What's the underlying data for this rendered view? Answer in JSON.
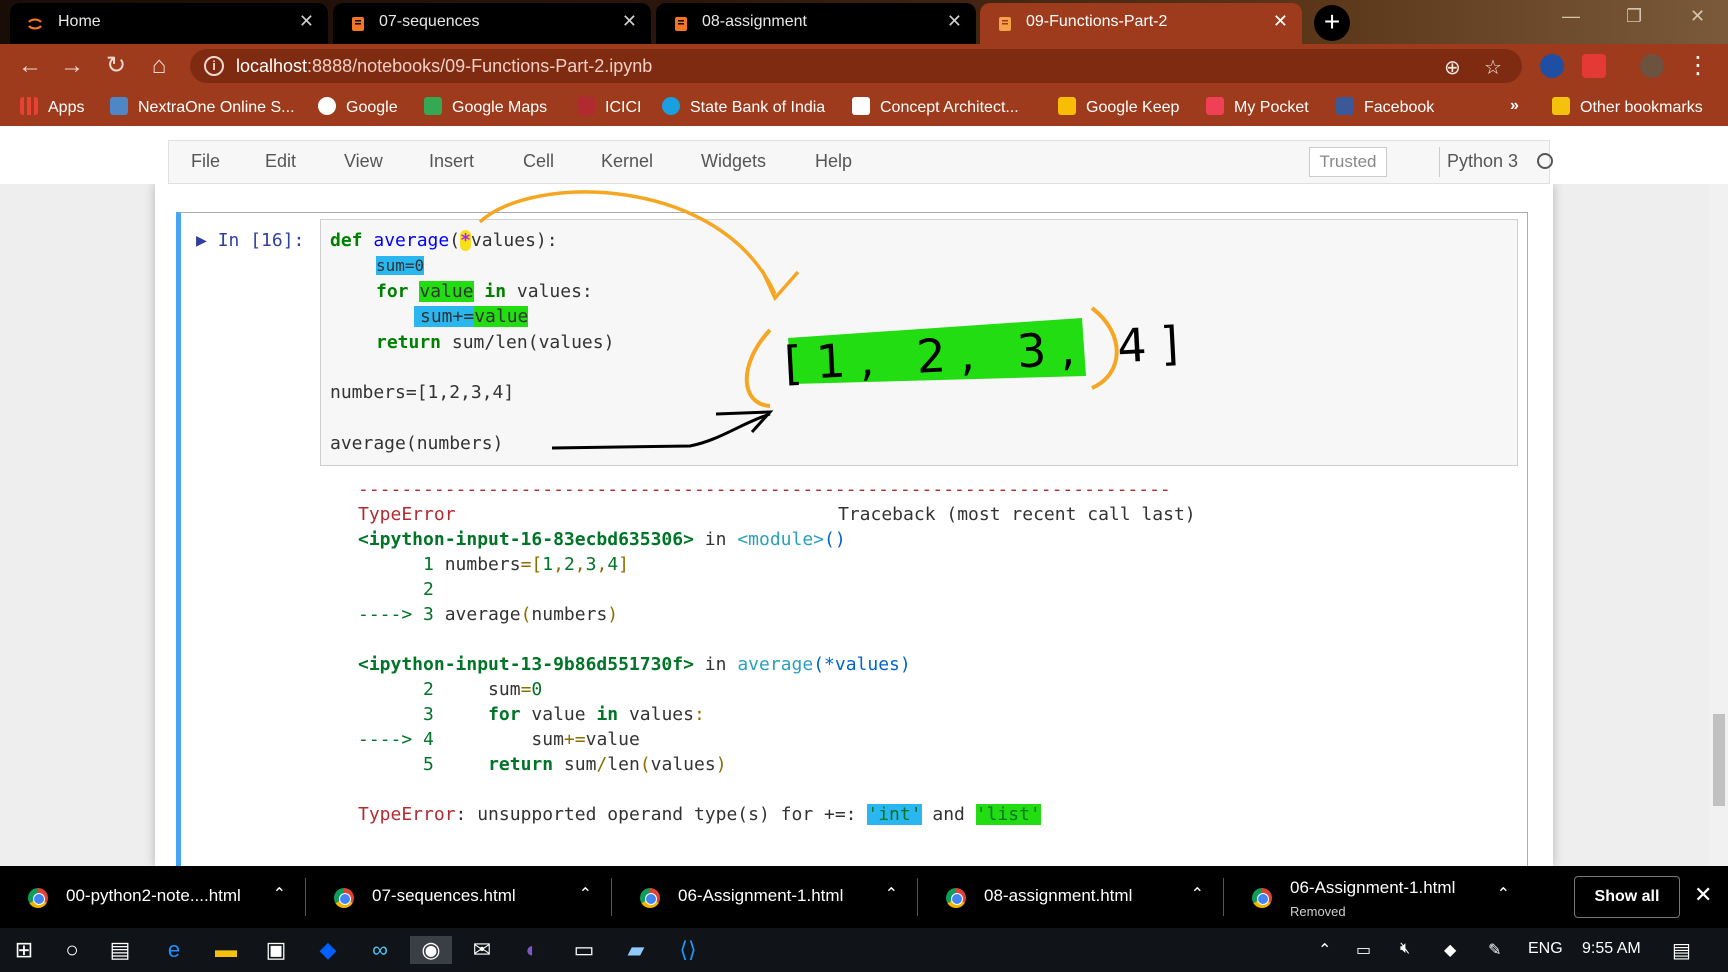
{
  "browser": {
    "tabs": [
      {
        "label": "Home",
        "icon": "jupyter-icon",
        "active": false
      },
      {
        "label": "07-sequences",
        "icon": "notebook-icon",
        "active": false
      },
      {
        "label": "08-assignment",
        "icon": "notebook-icon",
        "active": false
      },
      {
        "label": "09-Functions-Part-2",
        "icon": "notebook-icon",
        "active": true
      }
    ],
    "new_tab_label": "+",
    "url_host": "localhost",
    "url_path": ":8888/notebooks/09-Functions-Part-2.ipynb",
    "bookmarks": [
      {
        "label": "Apps"
      },
      {
        "label": "NextraOne Online S..."
      },
      {
        "label": "Google"
      },
      {
        "label": "Google Maps"
      },
      {
        "label": "ICICI"
      },
      {
        "label": "State Bank of India"
      },
      {
        "label": "Concept Architect..."
      },
      {
        "label": "Google Keep"
      },
      {
        "label": "My Pocket"
      },
      {
        "label": "Facebook"
      }
    ],
    "bookmarks_overflow": "»",
    "other_bookmarks": "Other bookmarks"
  },
  "jupyter": {
    "menu": [
      "File",
      "Edit",
      "View",
      "Insert",
      "Cell",
      "Kernel",
      "Widgets",
      "Help"
    ],
    "trusted": "Trusted",
    "kernel": "Python 3",
    "prompt": "In [16]:",
    "code": {
      "l1_def": "def",
      "l1_name": "average",
      "l1_star": "*",
      "l1_rest": "values):",
      "l2": "sum=0",
      "l3_for": "for",
      "l3_var": "value",
      "l3_in": "in",
      "l3_rest": " values:",
      "l4_a": "sum+=",
      "l4_b": "value",
      "l5_ret": "return",
      "l5_rest": " sum/len(values)",
      "l6": "numbers=[1,2,3,4]",
      "l7": "average(numbers)"
    },
    "annotation_list": "[1, 2, 3, 4]",
    "traceback": {
      "dashes": "---------------------------------------------------------------------------",
      "error_name": "TypeError",
      "header_right": "Traceback (most recent call last)",
      "frame1_file": "<ipython-input-16-83ecbd635306>",
      "frame1_in": "in",
      "frame1_func": "<module>",
      "frame1_parens": "()",
      "frame1_lines": [
        {
          "num": "1",
          "text": "numbers=[1,2,3,4]"
        },
        {
          "num": "2",
          "text": ""
        },
        {
          "num": "3",
          "text": "average(numbers)",
          "arrow": "---->"
        }
      ],
      "frame2_file": "<ipython-input-13-9b86d551730f>",
      "frame2_in": "in",
      "frame2_func": "average",
      "frame2_args": "(*values)",
      "frame2_lines": [
        {
          "num": "2",
          "text": "sum=0"
        },
        {
          "num": "3",
          "text": "for value in values:"
        },
        {
          "num": "4",
          "text": "sum+=value",
          "arrow": "---->"
        },
        {
          "num": "5",
          "text": "return sum/len(values)"
        }
      ],
      "final_name": "TypeError",
      "final_msg": ": unsupported operand type(s) for +=: ",
      "final_t1": "'int'",
      "final_and": " and ",
      "final_t2": "'list'"
    }
  },
  "downloads": [
    {
      "name": "00-python2-note....html",
      "sub": ""
    },
    {
      "name": "07-sequences.html",
      "sub": ""
    },
    {
      "name": "06-Assignment-1.html",
      "sub": ""
    },
    {
      "name": "08-assignment.html",
      "sub": ""
    },
    {
      "name": "06-Assignment-1.html",
      "sub": "Removed"
    }
  ],
  "show_all": "Show all",
  "taskbar": {
    "lang": "ENG",
    "time": "9:55 AM"
  },
  "colors": {
    "chrome_theme": "#9e3b1c",
    "highlight_blue": "#2ab7f0",
    "highlight_green": "#22dd11",
    "annotation_orange": "#f5a623",
    "cell_selected": "#42a5f5"
  }
}
